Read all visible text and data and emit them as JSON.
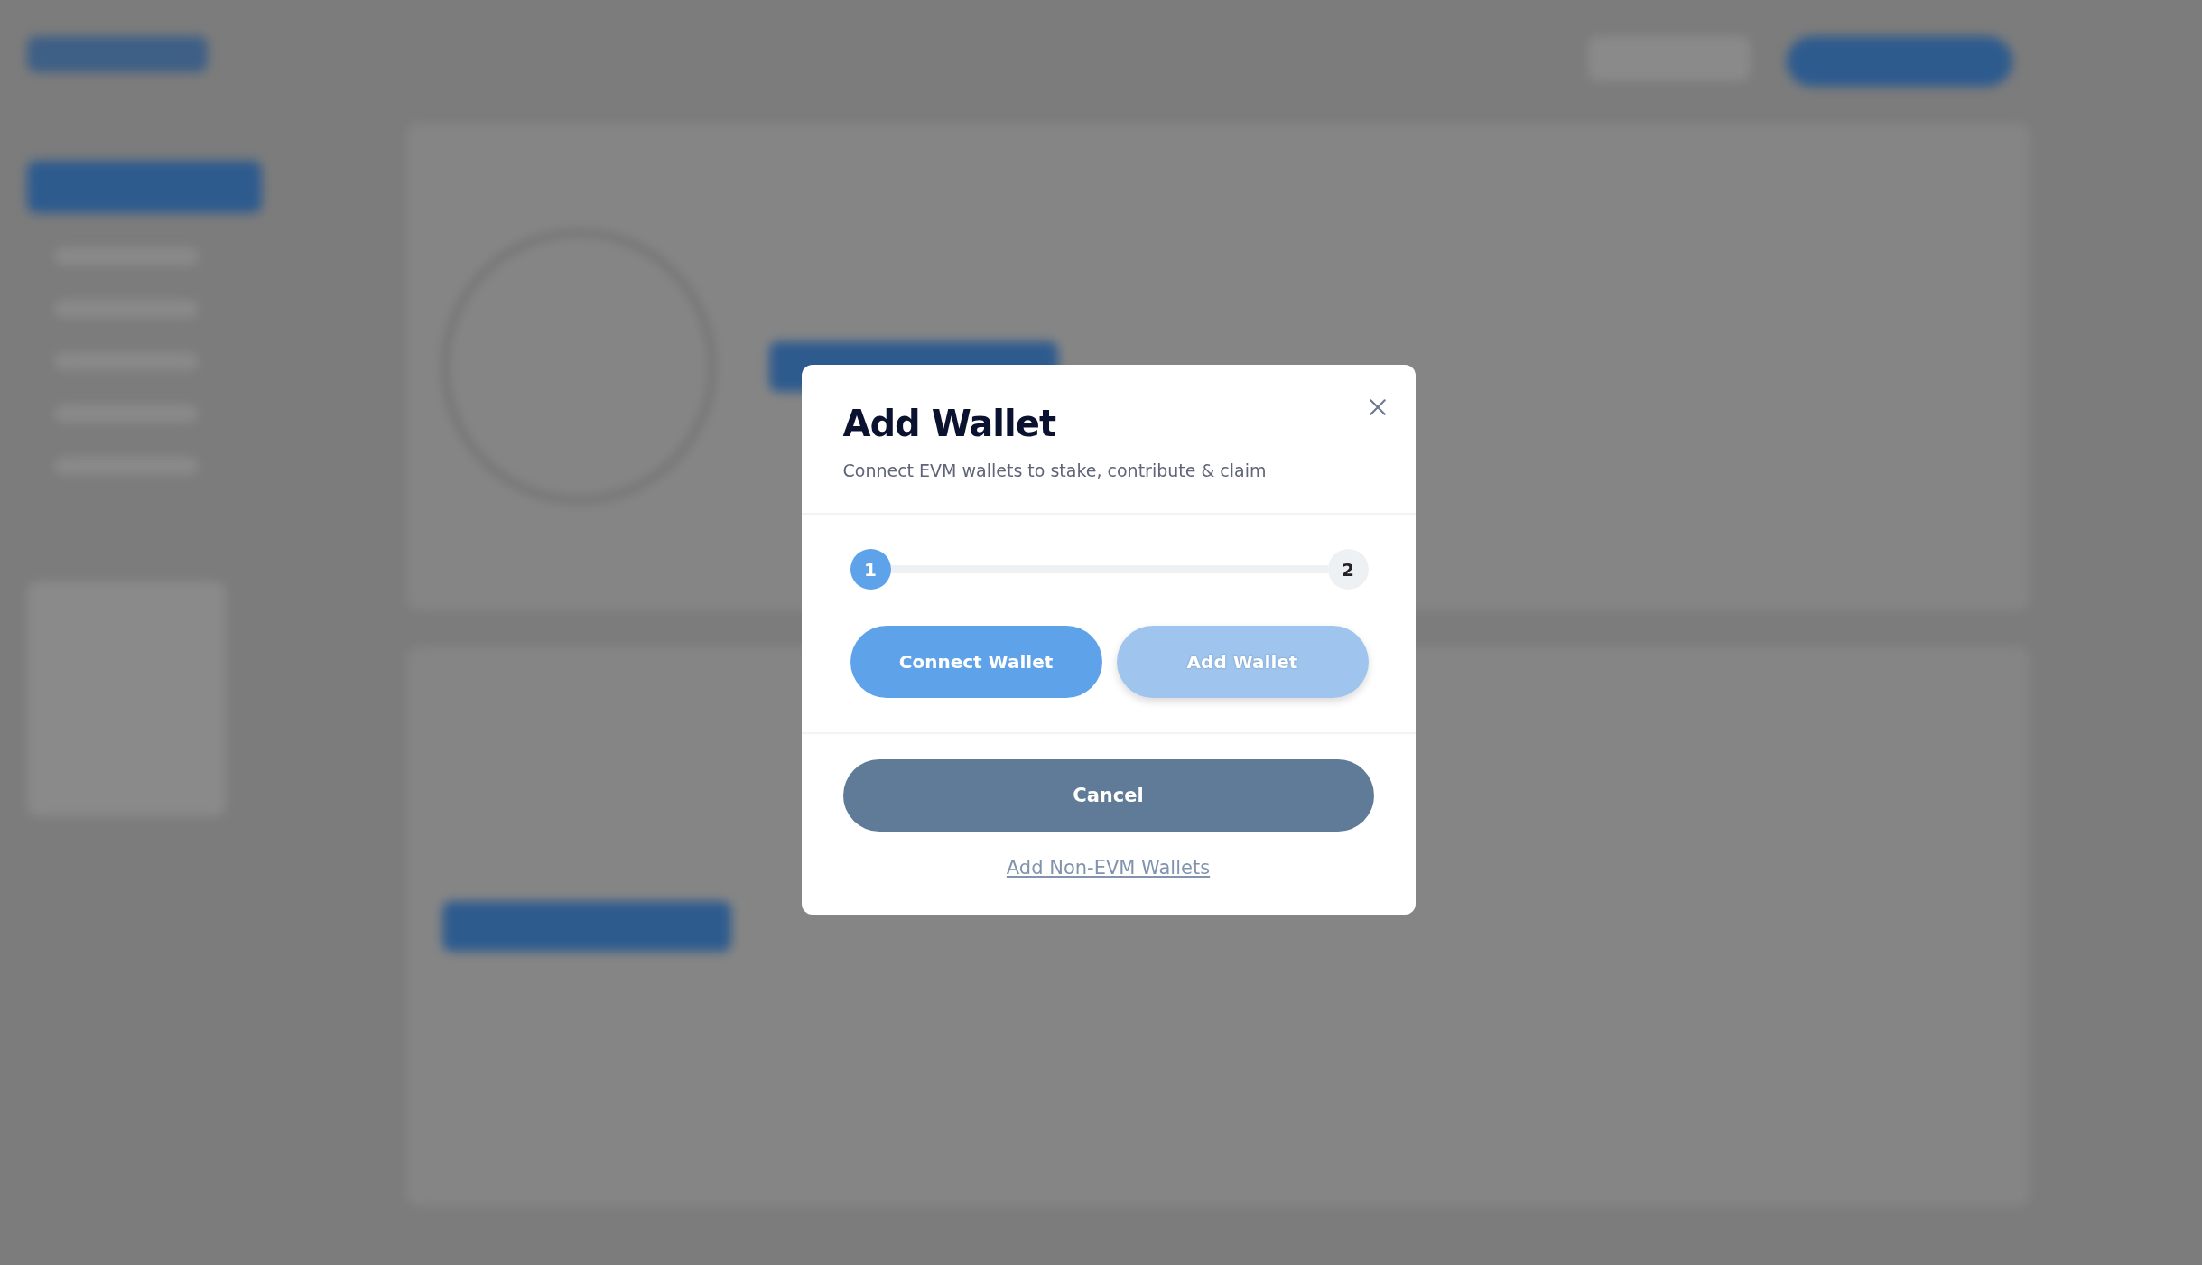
{
  "modal": {
    "title": "Add Wallet",
    "subtitle": "Connect EVM wallets to stake, contribute & claim",
    "steps": [
      {
        "label": "1",
        "selected": true
      },
      {
        "label": "2",
        "selected": false
      }
    ],
    "actions": [
      {
        "label": "Connect Wallet",
        "disabled": false
      },
      {
        "label": "Add Wallet",
        "disabled": true
      }
    ],
    "cancel": "Cancel",
    "link": "Add Non-EVM Wallets"
  }
}
